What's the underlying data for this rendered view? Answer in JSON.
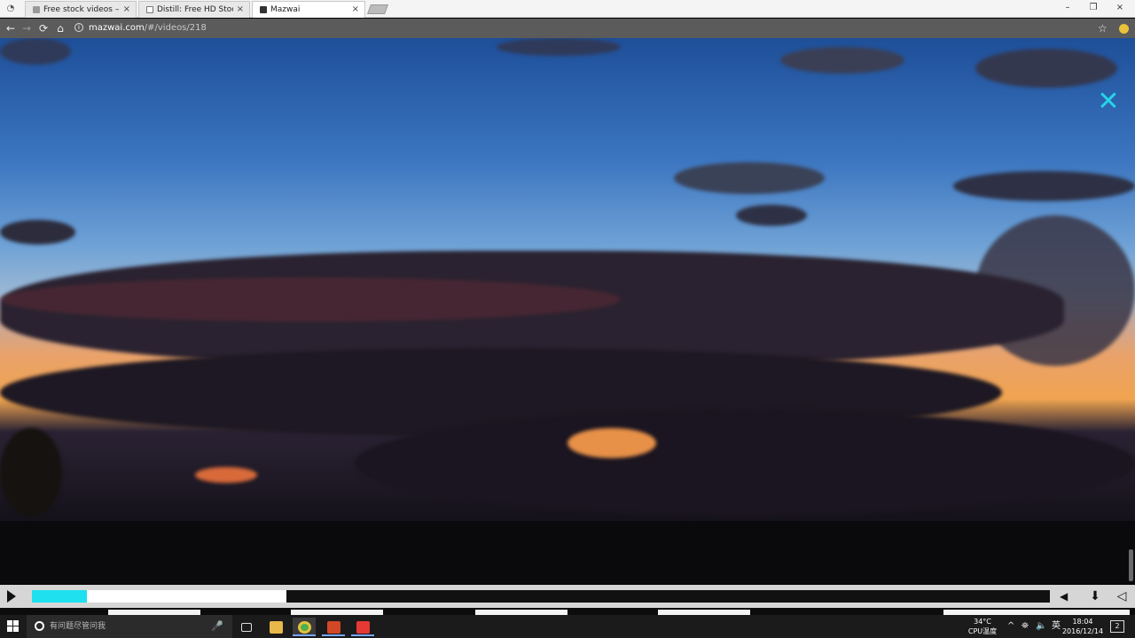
{
  "browser": {
    "tabs": [
      {
        "label": "Free stock videos – Pe",
        "close": "×",
        "active": false
      },
      {
        "label": "Distill: Free HD Stock V",
        "close": "×",
        "active": false
      },
      {
        "label": "Mazwai",
        "close": "×",
        "active": true
      }
    ],
    "window_controls": {
      "minimize": "–",
      "restore": "❐",
      "close": "×"
    },
    "url_host": "mazwai.com",
    "url_path": "/#/videos/218",
    "nav": {
      "back": "←",
      "forward": "→",
      "reload": "⟳",
      "home": "⌂"
    },
    "star": "☆"
  },
  "player": {
    "close_glyph": "✕",
    "progress_played": 0.054,
    "progress_buffered": 0.25,
    "volume_glyph": "◀",
    "download_glyph": "⬇",
    "collapse_glyph": "◁"
  },
  "taskbar": {
    "search_placeholder": "有问题尽管问我",
    "mic_glyph": "🎤",
    "cpu_temp": "34°C",
    "cpu_label": "CPU温度",
    "ime": "英",
    "time": "18:04",
    "date": "2016/12/14",
    "notification_count": "2",
    "tray_glyphs": {
      "chevron": "^",
      "network": "⛯",
      "volume": "🔈"
    },
    "pinned_apps": [
      {
        "name": "task-view",
        "color": "#1b1b1b"
      },
      {
        "name": "file-explorer",
        "color": "#e8b84a"
      },
      {
        "name": "chrome",
        "color": "#4caf50"
      },
      {
        "name": "powerpoint",
        "color": "#d24726"
      },
      {
        "name": "screen-recorder",
        "color": "#e53935"
      }
    ]
  },
  "colors": {
    "accent_cyan": "#1ee0ee",
    "control_bar": "#d6d6d6",
    "taskbar": "#1b1b1b"
  }
}
